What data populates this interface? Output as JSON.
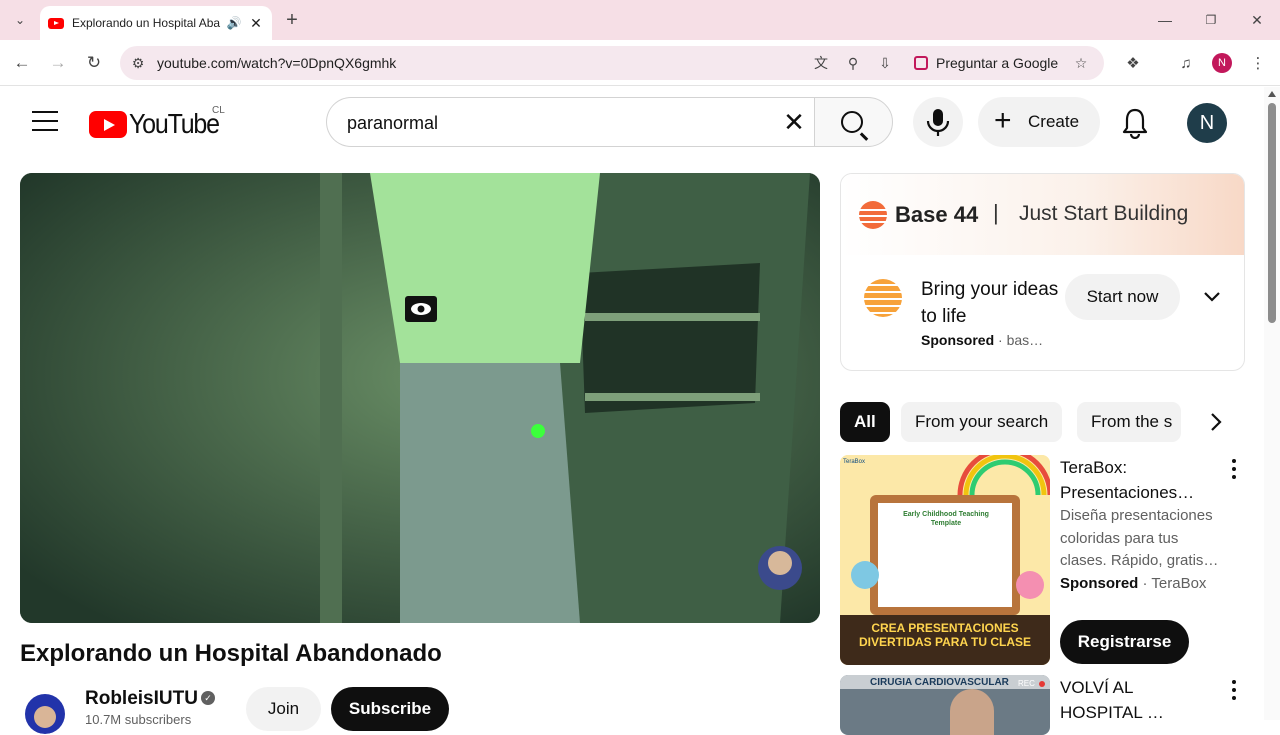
{
  "browser": {
    "tab_title": "Explorando un Hospital Aba",
    "url": "youtube.com/watch?v=0DpnQX6gmhk",
    "ask_google_label": "Preguntar a Google",
    "profile_initial": "N"
  },
  "header": {
    "logo_text": "YouTube",
    "country_code": "CL",
    "search_query": "paranormal",
    "create_label": "Create",
    "avatar_initial": "N"
  },
  "video": {
    "title": "Explorando un Hospital Abandonado",
    "channel_name": "RobleisIUTU",
    "subscribers": "10.7M subscribers",
    "join_label": "Join",
    "subscribe_label": "Subscribe"
  },
  "ad": {
    "brand": "Base 44",
    "tagline": "Just Start Building",
    "headline": "Bring your ideas to life",
    "sponsored_label": "Sponsored",
    "advertiser": "bas…",
    "cta_label": "Start now"
  },
  "chips": [
    {
      "label": "All"
    },
    {
      "label": "From your search"
    },
    {
      "label": "From the s"
    }
  ],
  "recs": [
    {
      "title_line1": "TeraBox:",
      "title_line2": "Presentaciones…",
      "desc": "Diseña presentaciones coloridas para tus clases. Rápido, gratis…",
      "sponsored_label": "Sponsored",
      "advertiser": "TeraBox",
      "cta_label": "Registrarse",
      "thumb_brand": "TeraBox",
      "thumb_heading": "Early Childhood Teaching Template",
      "thumb_banner": "CREA PRESENTACIONES DIVERTIDAS PARA TU CLASE"
    },
    {
      "title_line1": "VOLVÍ AL",
      "title_line2": "HOSPITAL …",
      "thumb_text": "CIRUGIA CARDIOVASCULAR",
      "thumb_rec": "REC"
    }
  ],
  "colors": {
    "brand_red": "#ff0000",
    "chrome_pink": "#f6dfe6",
    "nightvision_green": "#2f4b34"
  }
}
